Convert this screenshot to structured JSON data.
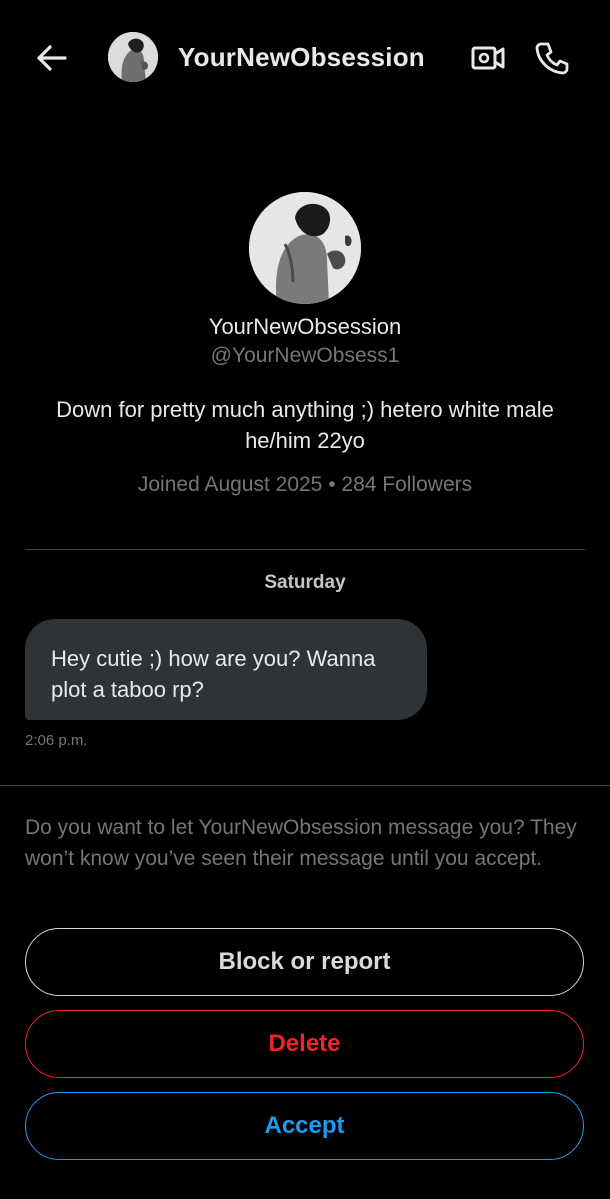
{
  "header": {
    "back_icon": "arrow-left-icon",
    "name": "YourNewObsession",
    "video_icon": "video-camera-icon",
    "phone_icon": "phone-icon"
  },
  "profile": {
    "name": "YourNewObsession",
    "handle": "@YourNewObsess1",
    "bio": "Down for pretty much anything ;) hetero white male he/him 22yo",
    "meta": "Joined August 2025 • 284 Followers"
  },
  "conversation": {
    "day_label": "Saturday",
    "messages": [
      {
        "text": "Hey cutie ;) how are you? Wanna plot a taboo rp?",
        "time": "2:06 p.m."
      }
    ]
  },
  "request": {
    "prompt": "Do you want to let YourNewObsession message you? They won’t know you’ve seen their message until you accept.",
    "block_label": "Block or report",
    "delete_label": "Delete",
    "accept_label": "Accept"
  },
  "colors": {
    "background": "#000000",
    "text_primary": "#e7e9ea",
    "text_secondary": "#71767b",
    "bubble": "#2f3336",
    "danger": "#f4212e",
    "accent": "#1d9bf0"
  }
}
